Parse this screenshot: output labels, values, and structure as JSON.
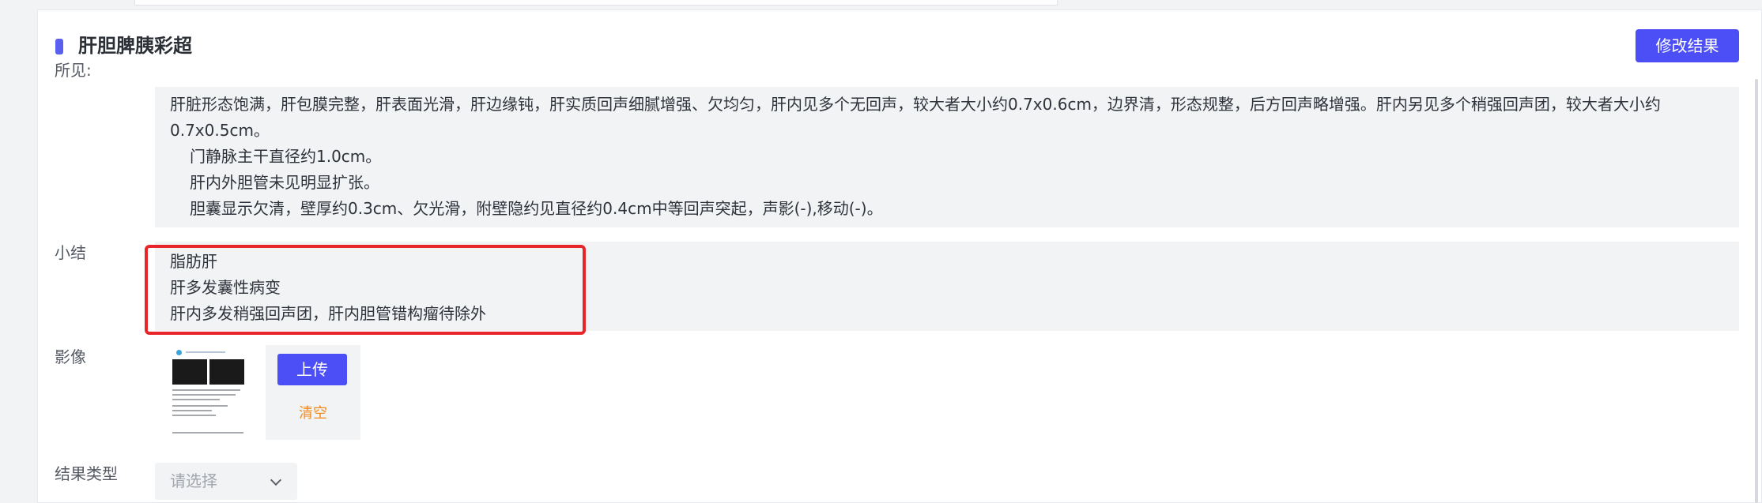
{
  "section": {
    "title": "肝胆脾胰彩超",
    "edit_button": "修改结果"
  },
  "findings": {
    "label": "所见:",
    "paragraphs": [
      "肝脏形态饱满，肝包膜完整，肝表面光滑，肝边缘钝，肝实质回声细腻增强、欠均匀，肝内见多个无回声，较大者大小约0.7x0.6cm，边界清，形态规整，后方回声略增强。肝内另见多个稍强回声团，较大者大小约0.7x0.5cm。",
      "门静脉主干直径约1.0cm。",
      "肝内外胆管未见明显扩张。",
      "胆囊显示欠清，壁厚约0.3cm、欠光滑，附壁隐约见直径约0.4cm中等回声突起，声影(-),移动(-)。"
    ]
  },
  "summary": {
    "label": "小结",
    "lines": [
      "脂肪肝",
      "肝多发囊性病变",
      "肝内多发稍强回声团，肝内胆管错构瘤待除外"
    ]
  },
  "images": {
    "label": "影像",
    "upload_button": "上传",
    "clear_link": "清空"
  },
  "result_type": {
    "label": "结果类型",
    "placeholder": "请选择"
  },
  "colors": {
    "accent": "#4b4ff5",
    "highlight_border": "#e8262a",
    "clear_link": "#f08a1c"
  }
}
